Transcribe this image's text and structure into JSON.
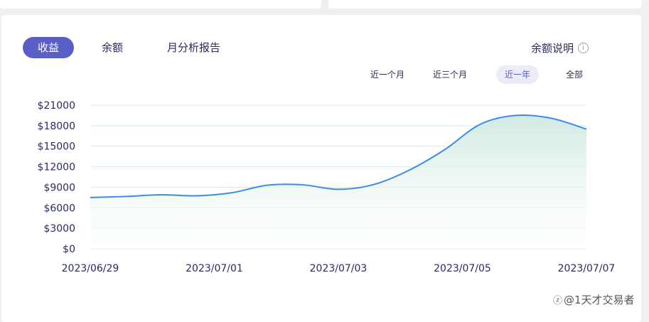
{
  "tabs": [
    {
      "label": "收益",
      "active": true
    },
    {
      "label": "余额",
      "active": false
    },
    {
      "label": "月分析报告",
      "active": false
    }
  ],
  "balance_help": {
    "label": "余额说明",
    "icon": "info-icon"
  },
  "range_buttons": [
    {
      "label": "近一个月",
      "active": false
    },
    {
      "label": "近三个月",
      "active": false
    },
    {
      "label": "近一年",
      "active": true
    },
    {
      "label": "全部",
      "active": false
    }
  ],
  "watermark": {
    "text": "@1天才交易者",
    "icon": "zhihu-logo-icon"
  },
  "colors": {
    "accent": "#5a5fc8",
    "line": "#3a8ee8",
    "area_top": "#cfe9e2",
    "grid": "#d4ece6"
  },
  "chart_data": {
    "type": "area",
    "title": "",
    "xlabel": "",
    "ylabel": "",
    "x_tick_labels": [
      "2023/06/29",
      "2023/07/01",
      "2023/07/03",
      "2023/07/05",
      "2023/07/07"
    ],
    "y_tick_labels": [
      "$0",
      "$3000",
      "$6000",
      "$9000",
      "$12000",
      "$15000",
      "$18000",
      "$21000"
    ],
    "ylim": [
      0,
      21000
    ],
    "grid": true,
    "series": [
      {
        "x": [
          "2023/06/29",
          "2023/06/30",
          "2023/07/01",
          "2023/07/01 12h",
          "2023/07/02",
          "2023/07/02 12h",
          "2023/07/03",
          "2023/07/03 12h",
          "2023/07/04",
          "2023/07/04 12h",
          "2023/07/05",
          "2023/07/05 12h",
          "2023/07/06",
          "2023/07/06 12h",
          "2023/07/07"
        ],
        "values": [
          7500,
          7650,
          7900,
          7750,
          8200,
          9300,
          9350,
          8700,
          9400,
          11500,
          14500,
          18200,
          19500,
          19100,
          17500
        ]
      }
    ]
  }
}
